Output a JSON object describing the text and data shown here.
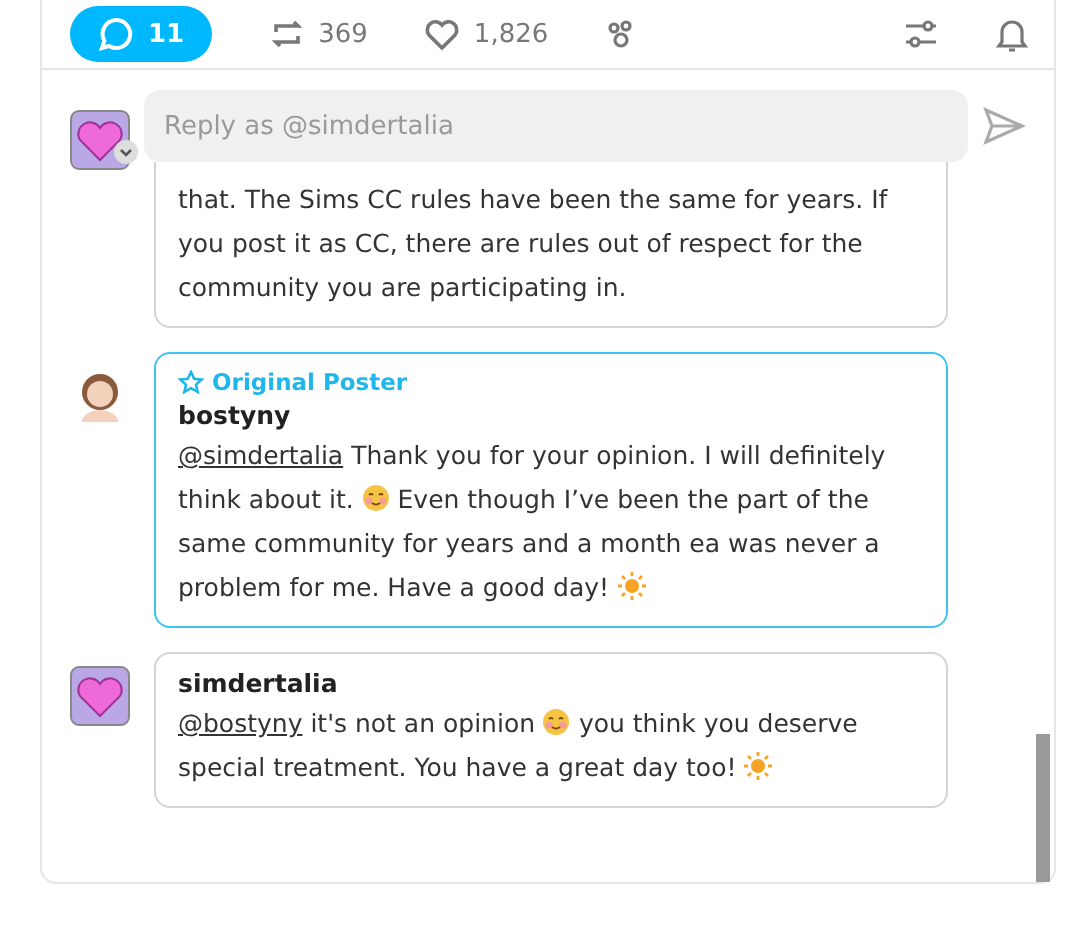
{
  "actions": [
    {
      "kind": "comments",
      "label": "11",
      "selected": true
    },
    {
      "kind": "reblogs",
      "label": "369",
      "selected": false
    },
    {
      "kind": "likes",
      "label": "1,826",
      "selected": false
    },
    {
      "kind": "reactions",
      "selected": false
    }
  ],
  "tools": [
    {
      "kind": "filter"
    },
    {
      "kind": "notify"
    }
  ],
  "reply": {
    "avatar": {
      "kind": "heart"
    },
    "placeholder": "Reply as @simdertalia"
  },
  "comments": [
    {
      "highlighted": false,
      "body": [
        {
          "kind": "text",
          "text": "that. The Sims CC rules have been the same for years. If you post it as CC, there are rules out of respect for the community you are participating in."
        }
      ]
    },
    {
      "avatar": {
        "kind": "person"
      },
      "highlighted": true,
      "badge": "Original Poster",
      "author": "bostyny",
      "body": [
        {
          "kind": "mention",
          "text": "@simdertalia"
        },
        {
          "kind": "text",
          "text": " Thank you for your opinion. I will definitely think about it. "
        },
        {
          "kind": "smile"
        },
        {
          "kind": "text",
          "text": " Even though I’ve been the part of the same community for years and a month ea was never a problem for me.  Have a good day! "
        },
        {
          "kind": "sun"
        }
      ]
    },
    {
      "avatar": {
        "kind": "heart"
      },
      "highlighted": false,
      "author": "simdertalia",
      "body": [
        {
          "kind": "mention",
          "text": "@bostyny"
        },
        {
          "kind": "text",
          "text": " it's not an opinion "
        },
        {
          "kind": "smile"
        },
        {
          "kind": "text",
          "text": " you think you deserve special treatment. You have a great day too! "
        },
        {
          "kind": "sun"
        }
      ]
    }
  ]
}
